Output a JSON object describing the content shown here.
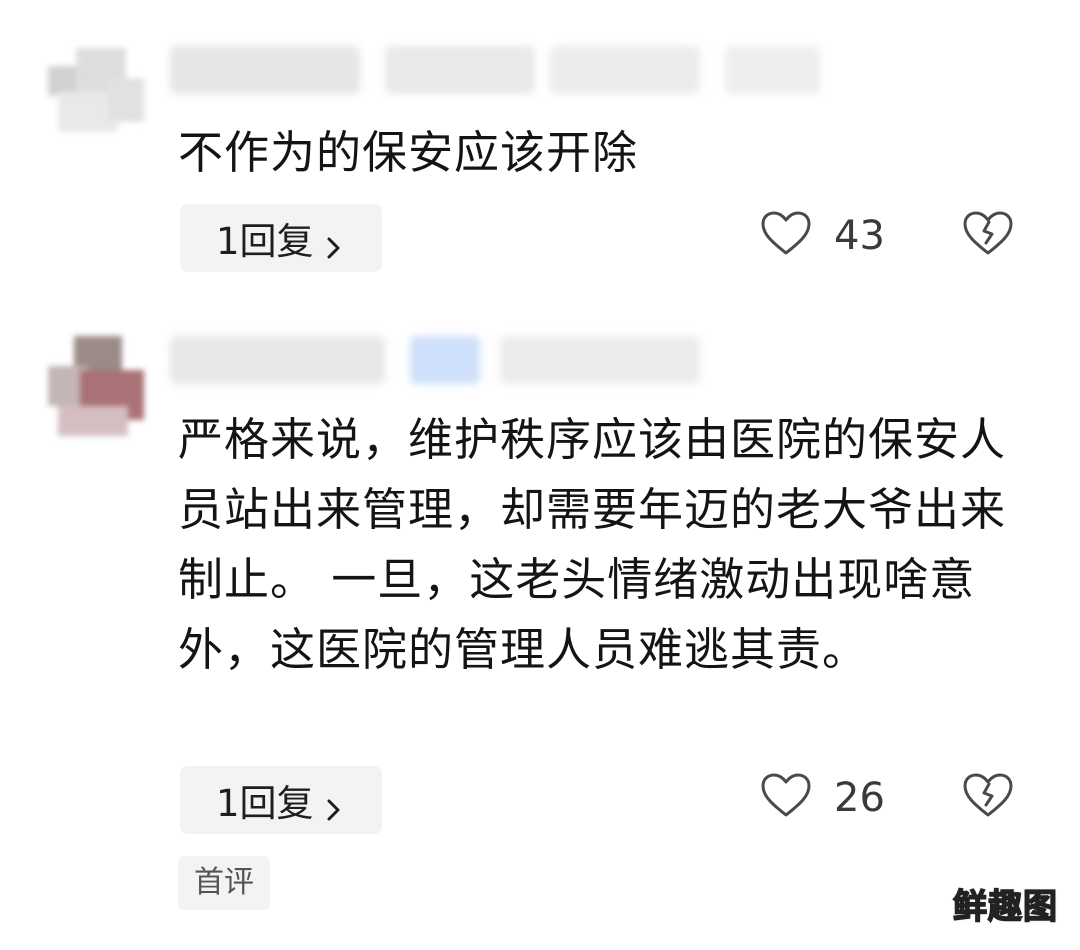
{
  "comments": [
    {
      "text": "不作为的保安应该开除",
      "reply_label": "1回复",
      "likes": "43"
    },
    {
      "text": "严格来说，维护秩序应该由医院的保安人员站出来管理，却需要年迈的老大爷出来制止。 一旦，这老头情绪激动出现啥意外，这医院的管理人员难逃其责。",
      "reply_label": "1回复",
      "likes": "26",
      "badge": "首评"
    }
  ],
  "watermark": "鲜趣图",
  "colors": {
    "background": "#ffffff",
    "text": "#141414",
    "reply_pill_bg": "#f3f3f3",
    "icon_stroke": "#4a4a4a",
    "count": "#3a3a3a"
  },
  "icons": {
    "like": "heart-outline-icon",
    "dislike": "broken-heart-icon",
    "reply_chevron": "chevron-right-icon"
  }
}
